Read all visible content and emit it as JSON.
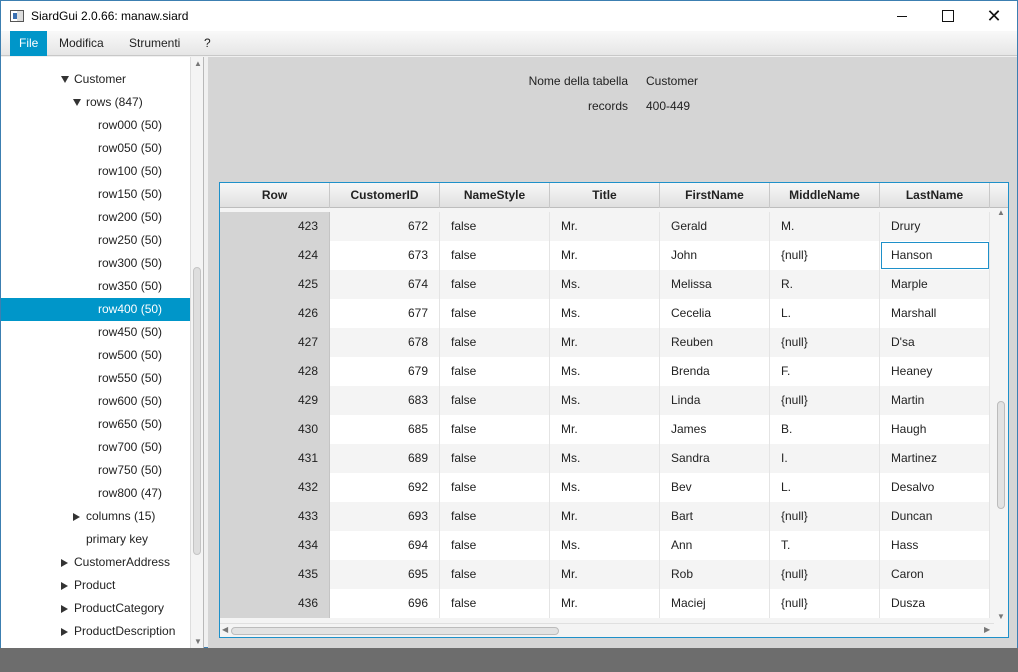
{
  "window": {
    "title": "SiardGui 2.0.66: manaw.siard",
    "minimize_icon": "minimize-icon",
    "maximize_icon": "maximize-icon",
    "close_icon": "close-icon",
    "close_glyph": "✕"
  },
  "menu": {
    "items": [
      "File",
      "Modifica",
      "Strumenti",
      "?"
    ]
  },
  "tree": {
    "items": [
      {
        "label": "Customer",
        "expander": "down"
      },
      {
        "label": "rows (847)",
        "expander": "down"
      },
      {
        "label": "row000 (50)",
        "expander": "none"
      },
      {
        "label": "row050 (50)",
        "expander": "none"
      },
      {
        "label": "row100 (50)",
        "expander": "none"
      },
      {
        "label": "row150 (50)",
        "expander": "none"
      },
      {
        "label": "row200 (50)",
        "expander": "none"
      },
      {
        "label": "row250 (50)",
        "expander": "none"
      },
      {
        "label": "row300 (50)",
        "expander": "none"
      },
      {
        "label": "row350 (50)",
        "expander": "none"
      },
      {
        "label": "row400 (50)",
        "expander": "none",
        "selected": true
      },
      {
        "label": "row450 (50)",
        "expander": "none"
      },
      {
        "label": "row500 (50)",
        "expander": "none"
      },
      {
        "label": "row550 (50)",
        "expander": "none"
      },
      {
        "label": "row600 (50)",
        "expander": "none"
      },
      {
        "label": "row650 (50)",
        "expander": "none"
      },
      {
        "label": "row700 (50)",
        "expander": "none"
      },
      {
        "label": "row750 (50)",
        "expander": "none"
      },
      {
        "label": "row800 (47)",
        "expander": "none"
      },
      {
        "label": "columns (15)",
        "expander": "right"
      },
      {
        "label": "primary key",
        "expander": "none"
      },
      {
        "label": "CustomerAddress",
        "expander": "right"
      },
      {
        "label": "Product",
        "expander": "right"
      },
      {
        "label": "ProductCategory",
        "expander": "right"
      },
      {
        "label": "ProductDescription",
        "expander": "right"
      }
    ],
    "selected_color": "#0096c9"
  },
  "details": {
    "table_name_label": "Nome della tabella",
    "table_name_value": "Customer",
    "records_label": "records",
    "records_value": "400-449"
  },
  "grid": {
    "columns": [
      "Row",
      "CustomerID",
      "NameStyle",
      "Title",
      "FirstName",
      "MiddleName",
      "LastName"
    ],
    "rows": [
      [
        "423",
        "672",
        "false",
        "Mr.",
        "Gerald",
        "M.",
        "Drury"
      ],
      [
        "424",
        "673",
        "false",
        "Mr.",
        "John",
        "{null}",
        "Hanson"
      ],
      [
        "425",
        "674",
        "false",
        "Ms.",
        "Melissa",
        "R.",
        "Marple"
      ],
      [
        "426",
        "677",
        "false",
        "Ms.",
        "Cecelia",
        "L.",
        "Marshall"
      ],
      [
        "427",
        "678",
        "false",
        "Mr.",
        "Reuben",
        "{null}",
        "D'sa"
      ],
      [
        "428",
        "679",
        "false",
        "Ms.",
        "Brenda",
        "F.",
        "Heaney"
      ],
      [
        "429",
        "683",
        "false",
        "Ms.",
        "Linda",
        "{null}",
        "Martin"
      ],
      [
        "430",
        "685",
        "false",
        "Mr.",
        "James",
        "B.",
        "Haugh"
      ],
      [
        "431",
        "689",
        "false",
        "Ms.",
        "Sandra",
        "I.",
        "Martinez"
      ],
      [
        "432",
        "692",
        "false",
        "Ms.",
        "Bev",
        "L.",
        "Desalvo"
      ],
      [
        "433",
        "693",
        "false",
        "Mr.",
        "Bart",
        "{null}",
        "Duncan"
      ],
      [
        "434",
        "694",
        "false",
        "Ms.",
        "Ann",
        "T.",
        "Hass"
      ],
      [
        "435",
        "695",
        "false",
        "Mr.",
        "Rob",
        "{null}",
        "Caron"
      ],
      [
        "436",
        "696",
        "false",
        "Mr.",
        "Maciej",
        "{null}",
        "Dusza"
      ]
    ],
    "focused_cell": {
      "row": 1,
      "col": 6
    },
    "accent_color": "#1e90c9"
  }
}
